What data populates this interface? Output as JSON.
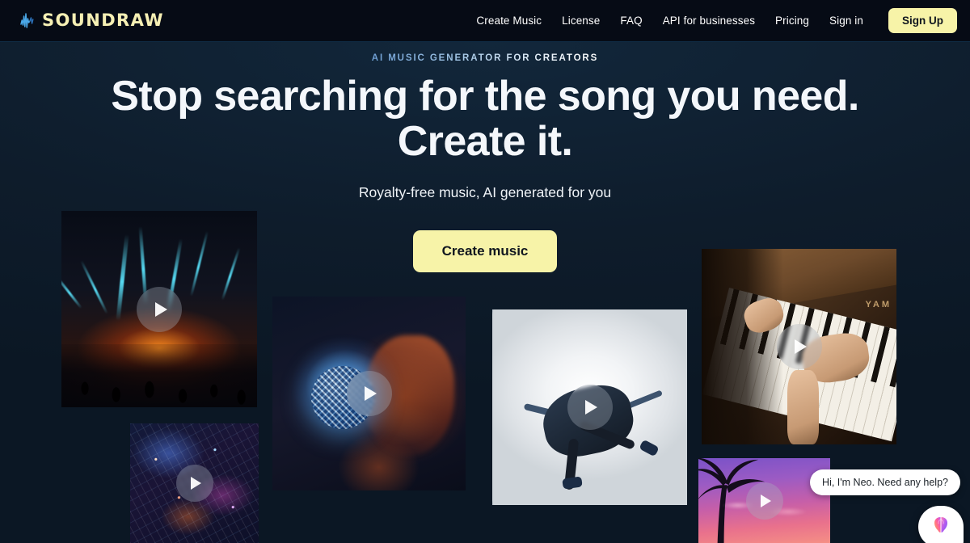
{
  "header": {
    "logo_text": "SOUNDRAW",
    "logo_icon": "waveform-icon",
    "nav": [
      {
        "label": "Create Music"
      },
      {
        "label": "License"
      },
      {
        "label": "FAQ"
      },
      {
        "label": "API for businesses"
      },
      {
        "label": "Pricing"
      },
      {
        "label": "Sign in"
      }
    ],
    "signup_label": "Sign Up"
  },
  "hero": {
    "eyebrow": "AI MUSIC GENERATOR FOR CREATORS",
    "headline_line1": "Stop searching for the song you need.",
    "headline_line2": "Create it.",
    "subtitle": "Royalty-free music, AI generated for you",
    "cta_label": "Create music"
  },
  "tiles": [
    {
      "name": "concert-lasers",
      "alt": "Concert stage with cyan laser beams and orange glow over a crowd",
      "play_icon": "play-icon"
    },
    {
      "name": "night-city",
      "alt": "Aerial night cityscape with neon blue and purple lights",
      "play_icon": "play-icon"
    },
    {
      "name": "disco-ball",
      "alt": "Woman holding a mirrored disco ball with blue light reflections",
      "play_icon": "play-icon"
    },
    {
      "name": "breakdancer",
      "alt": "Breakdancer mid-move in a bright white corridor",
      "play_icon": "play-icon"
    },
    {
      "name": "piano-hands",
      "alt": "Hands playing a wooden upright piano",
      "play_icon": "play-icon",
      "brand_text": "YAM"
    },
    {
      "name": "tropical-sunset",
      "alt": "Palm tree silhouettes against a purple and pink sunset sky",
      "play_icon": "play-icon"
    }
  ],
  "chat": {
    "message": "Hi, I'm Neo. Need any help?",
    "close_icon": "close-icon",
    "launcher_icon": "brain-icon"
  },
  "colors": {
    "page_bg": "#0e1c2b",
    "header_bg": "#060b15",
    "accent_yellow": "#f7f3a8",
    "logo_text": "#f6f0b4",
    "eyebrow_start": "#6f9fd4",
    "eyebrow_end": "#ffffff",
    "text_primary": "#f4f7fb"
  }
}
